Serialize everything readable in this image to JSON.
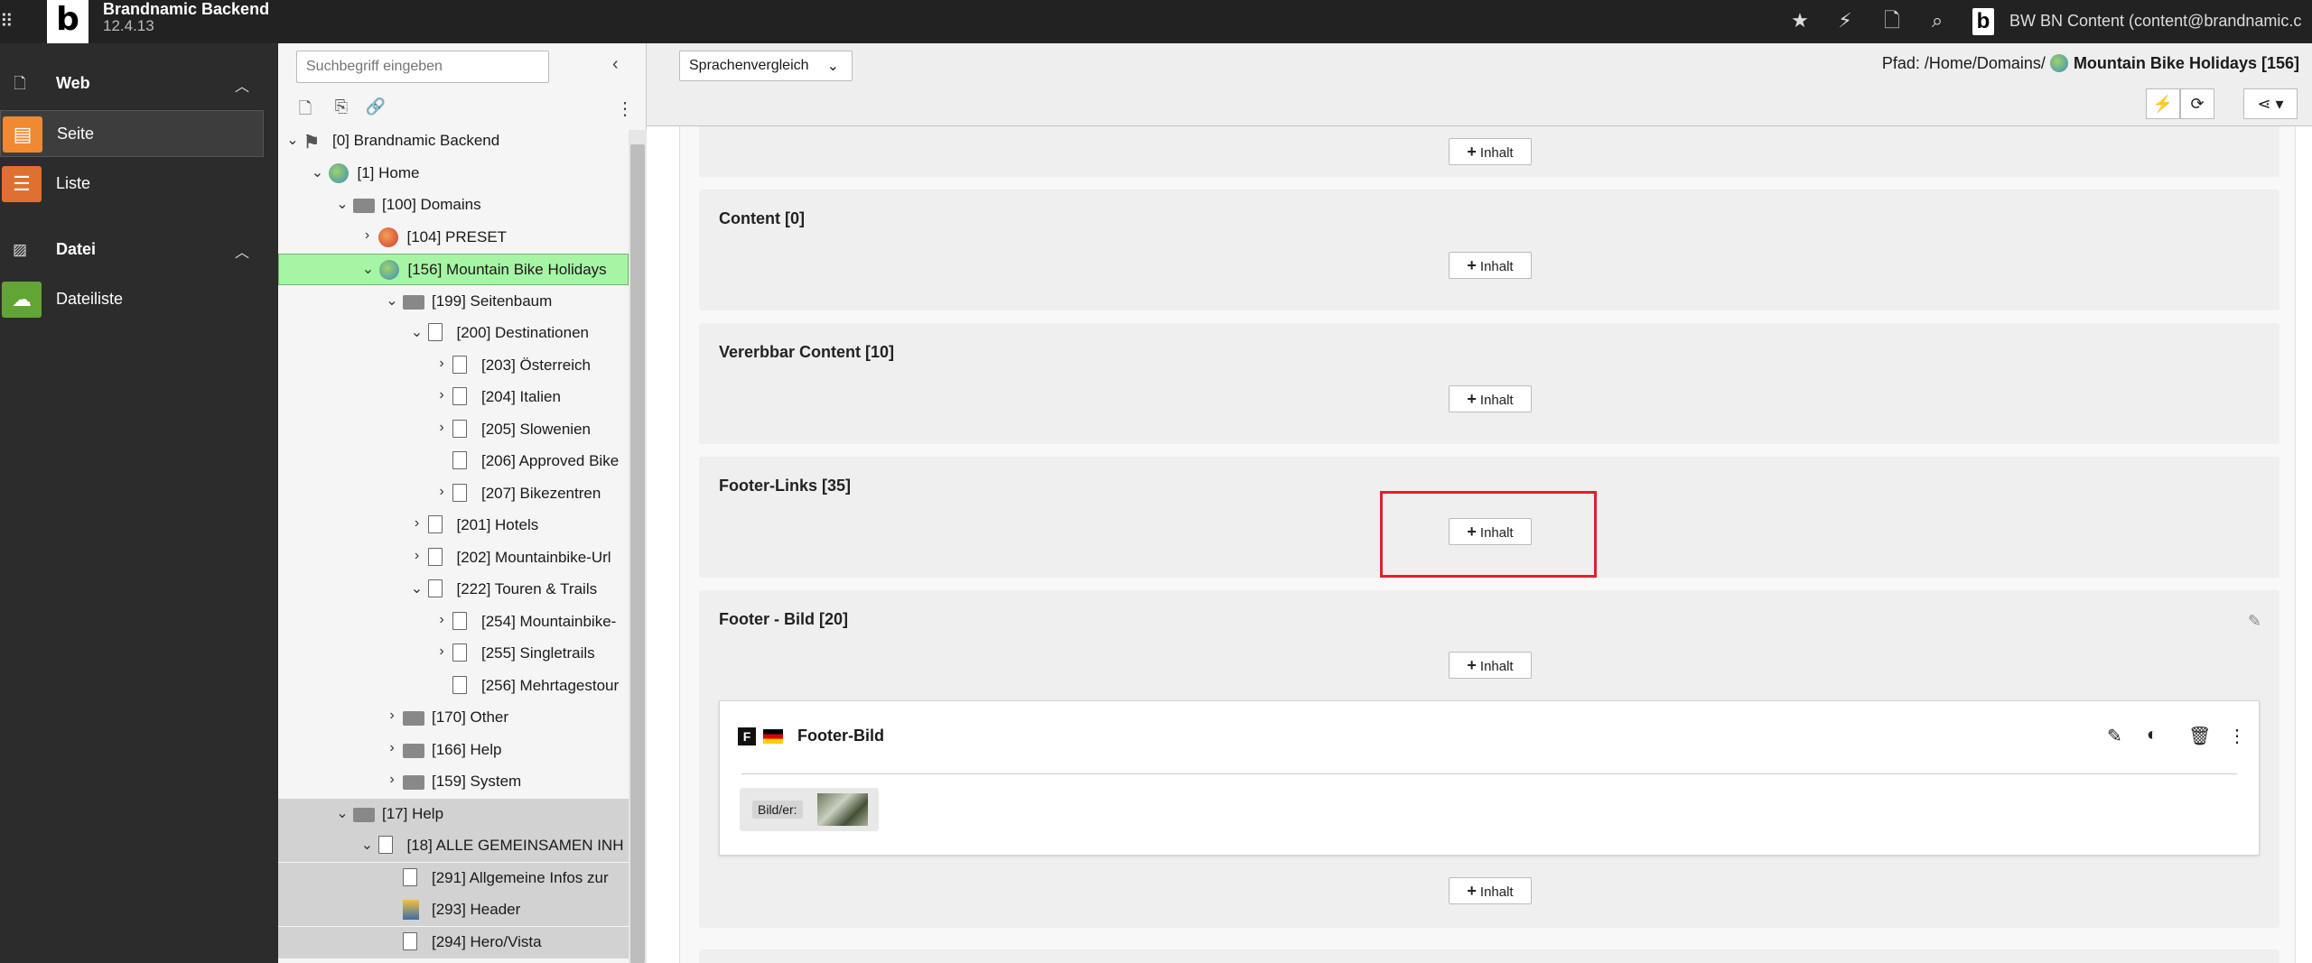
{
  "topbar": {
    "app_title": "Brandnamic Backend",
    "app_version": "12.4.13",
    "logo_letter": "b",
    "user_label": "BW BN Content (content@brandnamic.c",
    "icons": [
      "star-icon",
      "bolt-icon",
      "document-icon",
      "search-icon"
    ]
  },
  "modules": {
    "groups": [
      {
        "label": "Web",
        "icon": "page-icon"
      },
      {
        "label": "Datei",
        "icon": "image-icon"
      }
    ],
    "items": [
      {
        "label": "Seite",
        "color": "#f18932",
        "active": true
      },
      {
        "label": "Liste",
        "color": "#e0702f",
        "active": false
      },
      {
        "label": "Dateiliste",
        "color": "#63a534",
        "active": false
      }
    ]
  },
  "tree": {
    "search_placeholder": "Suchbegriff eingeben",
    "nodes": [
      {
        "label": "[0] Brandnamic Backend",
        "icon": "typo3",
        "depth": 0,
        "chev": "down",
        "state": ""
      },
      {
        "label": "[1] Home",
        "icon": "globe",
        "depth": 1,
        "chev": "down",
        "state": ""
      },
      {
        "label": "[100] Domains",
        "icon": "folder",
        "depth": 2,
        "chev": "down",
        "state": ""
      },
      {
        "label": "[104] PRESET",
        "icon": "globe-red",
        "depth": 3,
        "chev": "right",
        "state": ""
      },
      {
        "label": "[156] Mountain Bike Holidays",
        "icon": "globe",
        "depth": 3,
        "chev": "down",
        "state": "sel"
      },
      {
        "label": "[199] Seitenbaum",
        "icon": "folder",
        "depth": 4,
        "chev": "down",
        "state": ""
      },
      {
        "label": "[200] Destinationen",
        "icon": "page",
        "depth": 5,
        "chev": "down",
        "state": ""
      },
      {
        "label": "[203] Österreich",
        "icon": "page",
        "depth": 6,
        "chev": "right",
        "state": ""
      },
      {
        "label": "[204] Italien",
        "icon": "page",
        "depth": 6,
        "chev": "right",
        "state": ""
      },
      {
        "label": "[205] Slowenien",
        "icon": "page",
        "depth": 6,
        "chev": "right",
        "state": ""
      },
      {
        "label": "[206] Approved Bike",
        "icon": "page",
        "depth": 6,
        "chev": "",
        "state": ""
      },
      {
        "label": "[207] Bikezentren",
        "icon": "page",
        "depth": 6,
        "chev": "right",
        "state": ""
      },
      {
        "label": "[201] Hotels",
        "icon": "page",
        "depth": 5,
        "chev": "right",
        "state": ""
      },
      {
        "label": "[202] Mountainbike-Url",
        "icon": "page",
        "depth": 5,
        "chev": "right",
        "state": ""
      },
      {
        "label": "[222] Touren & Trails",
        "icon": "page",
        "depth": 5,
        "chev": "down",
        "state": ""
      },
      {
        "label": "[254] Mountainbike-",
        "icon": "page",
        "depth": 6,
        "chev": "right",
        "state": ""
      },
      {
        "label": "[255] Singletrails",
        "icon": "page",
        "depth": 6,
        "chev": "right",
        "state": ""
      },
      {
        "label": "[256] Mehrtagestour",
        "icon": "page",
        "depth": 6,
        "chev": "",
        "state": ""
      },
      {
        "label": "[170] Other",
        "icon": "folder",
        "depth": 4,
        "chev": "right",
        "state": ""
      },
      {
        "label": "[166] Help",
        "icon": "folder",
        "depth": 4,
        "chev": "right",
        "state": ""
      },
      {
        "label": "[159] System",
        "icon": "folder",
        "depth": 4,
        "chev": "right",
        "state": ""
      },
      {
        "label": "[17] Help",
        "icon": "folder",
        "depth": 2,
        "chev": "down",
        "state": "grey"
      },
      {
        "label": "[18] ALLE GEMEINSAMEN INH",
        "icon": "page",
        "depth": 3,
        "chev": "down",
        "state": "grey"
      },
      {
        "label": "[291] Allgemeine Infos zur",
        "icon": "page",
        "depth": 4,
        "chev": "",
        "state": "grey"
      },
      {
        "label": "[293] Header",
        "icon": "header",
        "depth": 4,
        "chev": "",
        "state": "grey"
      },
      {
        "label": "[294] Hero/Vista",
        "icon": "page",
        "depth": 4,
        "chev": "",
        "state": "grey"
      }
    ]
  },
  "docheader": {
    "language_select": "Sprachenvergleich",
    "path_prefix": "Pfad: /Home/Domains/",
    "path_page": "Mountain Bike Holidays [156]"
  },
  "content": {
    "add_label": "Inhalt",
    "sections": [
      {
        "title": ""
      },
      {
        "title": "Content [0]"
      },
      {
        "title": "Vererbbar Content [10]"
      },
      {
        "title": "Footer-Links [35]"
      },
      {
        "title": "Footer - Bild [20]"
      }
    ],
    "element": {
      "title": "Footer-Bild",
      "type_letter": "F",
      "files_label": "Bild/er:"
    }
  }
}
